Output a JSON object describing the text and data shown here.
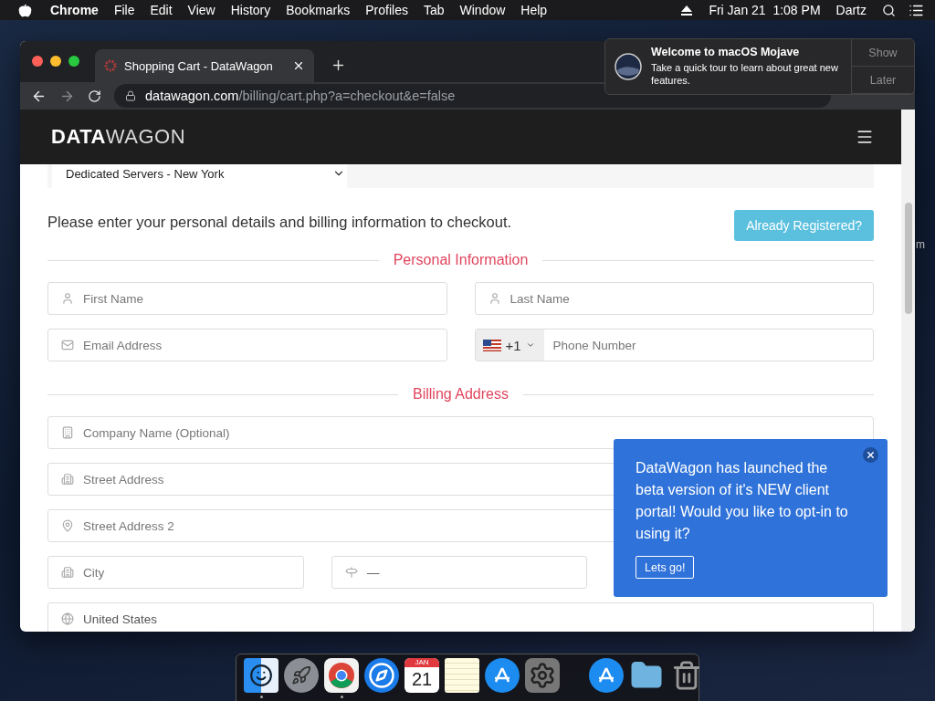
{
  "menubar": {
    "app": "Chrome",
    "menus": [
      "File",
      "Edit",
      "View",
      "History",
      "Bookmarks",
      "Profiles",
      "Tab",
      "Window",
      "Help"
    ],
    "clock": "Fri Jan 21  1:08 PM",
    "user": "Dartz"
  },
  "desktop_label": "m",
  "browser": {
    "tab_title": "Shopping Cart - DataWagon",
    "url_host": "datawagon.com",
    "url_path": "/billing/cart.php?a=checkout&e=false"
  },
  "site": {
    "logo_bold": "DATA",
    "logo_light": "WAGON",
    "category_select": "Dedicated Servers - New York",
    "intro": "Please enter your personal details and billing information to checkout.",
    "login_button": "Already Registered?",
    "sections": [
      {
        "heading": "Personal Information",
        "rows": [
          [
            {
              "kind": "text",
              "placeholder": "First Name"
            },
            {
              "kind": "text",
              "placeholder": "Last Name"
            }
          ],
          [
            {
              "kind": "text",
              "placeholder": "Email Address"
            },
            {
              "kind": "phone",
              "code": "+1",
              "placeholder": "Phone Number"
            }
          ]
        ]
      },
      {
        "heading": "Billing Address",
        "rows": [
          [
            {
              "kind": "text",
              "placeholder": "Company Name (Optional)"
            }
          ],
          [
            {
              "kind": "text",
              "placeholder": "Street Address"
            }
          ],
          [
            {
              "kind": "text",
              "placeholder": "Street Address 2"
            }
          ],
          [
            {
              "kind": "text",
              "placeholder": "City"
            },
            {
              "kind": "select",
              "value": "—"
            }
          ],
          [
            {
              "kind": "select",
              "value": "United States"
            }
          ]
        ]
      }
    ]
  },
  "popup": {
    "text": "DataWagon has launched the beta version of it's NEW client portal! Would you like to opt-in to using it?",
    "button": "Lets go!"
  },
  "notification": {
    "title": "Welcome to macOS Mojave",
    "body": "Take a quick tour to learn about great new features.",
    "actions": [
      "Show",
      "Later"
    ]
  },
  "dock": [
    {
      "kind": "finder",
      "running": true
    },
    {
      "kind": "launchpad",
      "running": false
    },
    {
      "kind": "chrome",
      "running": true
    },
    {
      "kind": "safari",
      "running": false
    },
    {
      "kind": "calendar",
      "running": false,
      "month": "JAN",
      "day": "21"
    },
    {
      "kind": "notes",
      "running": false
    },
    {
      "kind": "appstore",
      "running": false
    },
    {
      "kind": "settings",
      "running": false
    },
    {
      "kind": "separator"
    },
    {
      "kind": "appstore",
      "running": false
    },
    {
      "kind": "folder",
      "running": false
    },
    {
      "kind": "trash",
      "running": false
    }
  ]
}
